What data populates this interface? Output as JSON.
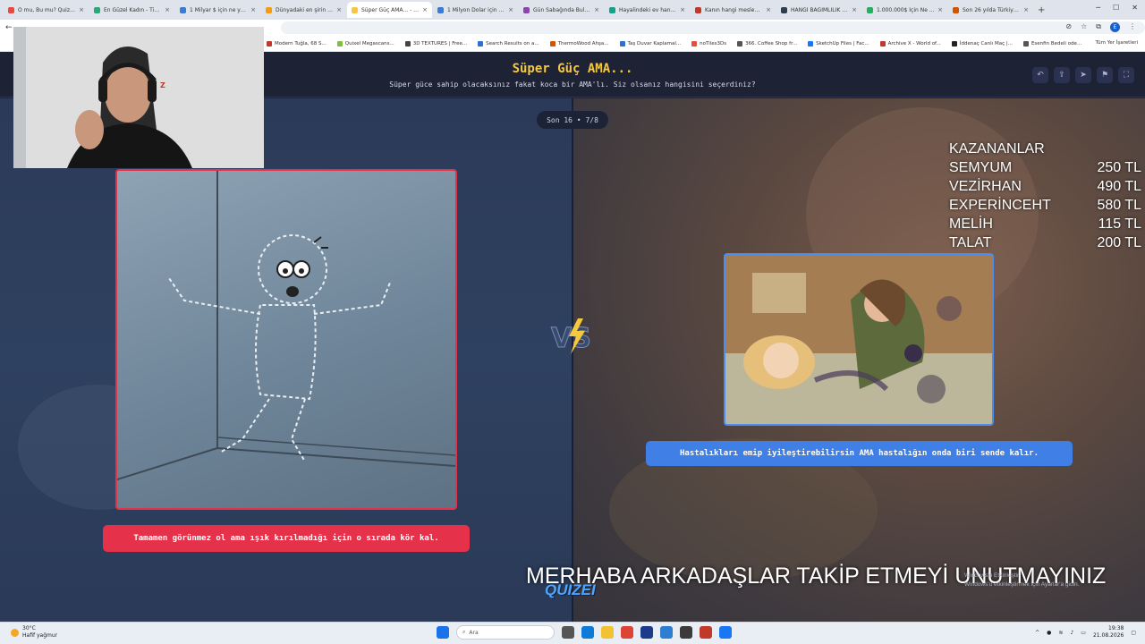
{
  "browser": {
    "tabs": [
      {
        "label": "O mu, Bu mu? Quizler!",
        "fav": "#e84b3c"
      },
      {
        "label": "En Güzel Kadın - Tier ...",
        "fav": "#2aa876"
      },
      {
        "label": "1 Milyar $ için ne yapar...",
        "fav": "#3a7bd5"
      },
      {
        "label": "Dünyadaki en şirin Ka...",
        "fav": "#f39c12"
      },
      {
        "label": "Süper Güç AMA... - Tie...",
        "fav": "#f5c842",
        "active": true
      },
      {
        "label": "1 Milyon Dolar için Ne...",
        "fav": "#3a7bd5"
      },
      {
        "label": "Gün Sabağında Bulunc...",
        "fav": "#8e44ad"
      },
      {
        "label": "Hayalindeki ev hangis...",
        "fav": "#16a085"
      },
      {
        "label": "Kanın hangi mesleği ya...",
        "fav": "#c0392b"
      },
      {
        "label": "HANGİ BAĞIMLILIK ES...",
        "fav": "#2c3e50"
      },
      {
        "label": "1.000.000$ İçin Ne Yap...",
        "fav": "#27ae60"
      },
      {
        "label": "Son 26 yılda Türkiye'yi...",
        "fav": "#d35400"
      }
    ],
    "profile_initial": "E",
    "bookmarks": [
      {
        "label": "Modern Tuğla, 68 S...",
        "fav": "#c0392b"
      },
      {
        "label": "Quixel Megascans...",
        "fav": "#7fbf3f"
      },
      {
        "label": "3D TEXTURES | Free...",
        "fav": "#444444"
      },
      {
        "label": "Search Results on a...",
        "fav": "#2a70d8"
      },
      {
        "label": "ThermoWood Ahşa...",
        "fav": "#d35400"
      },
      {
        "label": "Taş Duvar Kaplamal...",
        "fav": "#2a70d8"
      },
      {
        "label": "noTiles3Ds",
        "fav": "#e74c3c"
      },
      {
        "label": "366. Coffee Shop fr...",
        "fav": "#555555"
      },
      {
        "label": "SketchUp Files | Fac...",
        "fav": "#1877f2"
      },
      {
        "label": "Archive X - World of...",
        "fav": "#c0392b"
      },
      {
        "label": "İddenaç Canlı Maç |...",
        "fav": "#222222"
      },
      {
        "label": "Esenfin Bedeli ode...",
        "fav": "#555555"
      }
    ],
    "bookmarks_right": "Tüm Yer İşaretleri"
  },
  "app": {
    "title": "Süper Güç AMA...",
    "subtitle": "Süper güce sahip olacaksınız fakat koca bir AMA'lı. Siz olsanız hangisini seçerdiniz?",
    "round": "Son 16 • 7/8",
    "option_left": "Tamamen görünmez ol ama ışık kırılmadığı için o sırada kör kal.",
    "option_right": "Hastalıkları emip iyileştirebilirsin AMA hastalığın onda biri sende kalır.",
    "vs": "VS",
    "accent_left": "#e5324a",
    "accent_right": "#3f7fe6",
    "title_color": "#f5c842"
  },
  "stream": {
    "winners_title": "KAZANANLAR",
    "winners": [
      {
        "name": "SEMYUM",
        "amount": "250 TL"
      },
      {
        "name": "VEZİRHAN",
        "amount": "490 TL"
      },
      {
        "name": "EXPERİNCEHT",
        "amount": "580 TL"
      },
      {
        "name": "MELİH",
        "amount": "115 TL"
      },
      {
        "name": "TALAT",
        "amount": "200 TL"
      }
    ],
    "ticker": "MERHABA ARKADAŞLAR TAKİP ETMEYİ UNUTMAYINIZ",
    "brand": "QUIZEI",
    "activate_line1": "Windows'u Etkinleştir",
    "activate_line2": "Windows'u etkinleştirmek için Ayarlar'a gidin."
  },
  "taskbar": {
    "temp": "30°C",
    "weather": "Hafif yağmur",
    "search": "Ara",
    "time": "19:38",
    "date": "21.08.2026"
  }
}
